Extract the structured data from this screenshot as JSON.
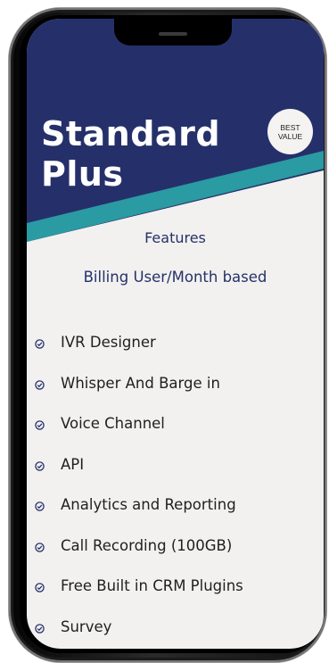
{
  "colors": {
    "header_navy": "#25306a",
    "accent_teal": "#2a9aa3",
    "heading_text": "#25316a",
    "body_text": "#1f1f1f",
    "background": "#f2f1ef",
    "check_icon": "#25306a"
  },
  "plan": {
    "title_line1": "Standard",
    "title_line2": "Plus",
    "badge_line1": "BEST",
    "badge_line2": "VALUE"
  },
  "features_title": "Features",
  "billing_basis": "Billing User/Month based",
  "features": [
    {
      "label": "IVR Designer",
      "icon": "check-circle-icon"
    },
    {
      "label": "Whisper And Barge in",
      "icon": "check-circle-icon"
    },
    {
      "label": "Voice Channel",
      "icon": "check-circle-icon"
    },
    {
      "label": "API",
      "icon": "check-circle-icon"
    },
    {
      "label": "Analytics and Reporting",
      "icon": "check-circle-icon"
    },
    {
      "label": "Call Recording (100GB)",
      "icon": "check-circle-icon"
    },
    {
      "label": "Free Built in CRM Plugins",
      "icon": "check-circle-icon"
    },
    {
      "label": "Survey",
      "icon": "check-circle-icon"
    }
  ]
}
